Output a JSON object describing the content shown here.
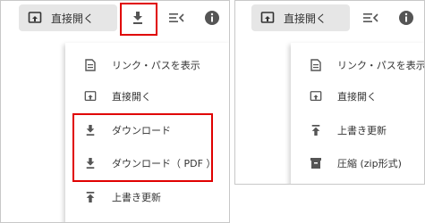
{
  "colors": {
    "highlight": "#e00000",
    "button_bg": "#e6e6e6",
    "icon": "#555555"
  },
  "left": {
    "toolbar": {
      "open_label": "直接開く",
      "icons": [
        "download-icon",
        "collapse-list-icon",
        "info-icon"
      ]
    },
    "menu": [
      {
        "label": "リンク・パスを表示",
        "icon": "document-icon"
      },
      {
        "label": "直接開く",
        "icon": "open-in-icon"
      },
      {
        "label": "ダウンロード",
        "icon": "download-icon"
      },
      {
        "label": "ダウンロード（ PDF ）",
        "icon": "download-icon"
      },
      {
        "label": "上書き更新",
        "icon": "upload-icon"
      }
    ]
  },
  "right": {
    "toolbar": {
      "open_label": "直接開く",
      "icons": [
        "collapse-list-icon",
        "info-icon"
      ]
    },
    "menu": [
      {
        "label": "リンク・パスを表示",
        "icon": "document-icon"
      },
      {
        "label": "直接開く",
        "icon": "open-in-icon"
      },
      {
        "label": "上書き更新",
        "icon": "upload-icon"
      },
      {
        "label": "圧縮 (zip形式)",
        "icon": "archive-icon"
      }
    ]
  }
}
